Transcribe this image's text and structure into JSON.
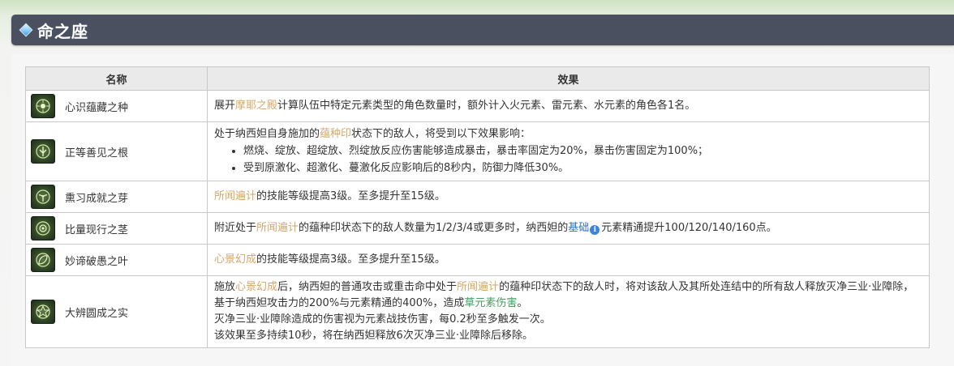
{
  "header": {
    "title": "命之座"
  },
  "table": {
    "headers": {
      "name": "名称",
      "effect": "效果"
    },
    "rows": [
      {
        "name": "心识蕴藏之种",
        "icon": "constellation-seed-icon",
        "effect": {
          "p1_a": "展开",
          "p1_link": "摩耶之殿",
          "p1_b": "计算队伍中特定元素类型的角色数量时，额外计入火元素、雷元素、水元素的角色各1名。"
        }
      },
      {
        "name": "正等善见之根",
        "icon": "constellation-root-icon",
        "effect": {
          "p1_a": "处于纳西妲自身施加的",
          "p1_link": "蕴种印",
          "p1_b": "状态下的敌人，将受到以下效果影响：",
          "bullets": [
            "燃烧、绽放、超绽放、烈绽放反应伤害能够造成暴击，暴击率固定为20%，暴击伤害固定为100%；",
            "受到原激化、超激化、蔓激化反应影响后的8秒内，防御力降低30%。"
          ]
        }
      },
      {
        "name": "熏习成就之芽",
        "icon": "constellation-sprout-icon",
        "effect": {
          "p1_link": "所闻遍计",
          "p1_b": "的技能等级提高3级。至多提升至15级。"
        }
      },
      {
        "name": "比量现行之茎",
        "icon": "constellation-stem-icon",
        "effect": {
          "p1_a": "附近处于",
          "p1_link": "所闻遍计",
          "p1_b": "的蕴种印状态下的敌人数量为1/2/3/4或更多时，纳西妲的",
          "p1_link2": "基础",
          "p1_c": "元素精通提升100/120/140/160点。"
        }
      },
      {
        "name": "妙谛破愚之叶",
        "icon": "constellation-leaf-icon",
        "effect": {
          "p1_link": "心景幻成",
          "p1_b": "的技能等级提高3级。至多提升至15级。"
        }
      },
      {
        "name": "大辨圆成之实",
        "icon": "constellation-fruit-icon",
        "effect": {
          "p1_a": "施放",
          "p1_link": "心景幻成",
          "p1_b": "后，纳西妲的普通攻击或重击命中处于",
          "p1_link2": "所闻遍计",
          "p1_c": "的蕴种印状态下的敌人时，将对该敌人及其所处连结中的所有敌人释放灭净三业·业障除，基于纳西妲攻击力的200%与元素精通的400%，造成",
          "p1_green": "草元素伤害",
          "p1_d": "。",
          "p2": "灭净三业·业障除造成的伤害视为元素战技伤害，每0.2秒至多触发一次。",
          "p3": "该效果至多持续10秒，将在纳西妲释放6次灭净三业·业障除后移除。"
        }
      }
    ]
  },
  "colors": {
    "header_bg": "#4a5060",
    "link_gold": "#d4a76a",
    "link_blue": "#2f6fcb",
    "dendro_green": "#4a9a5e"
  }
}
